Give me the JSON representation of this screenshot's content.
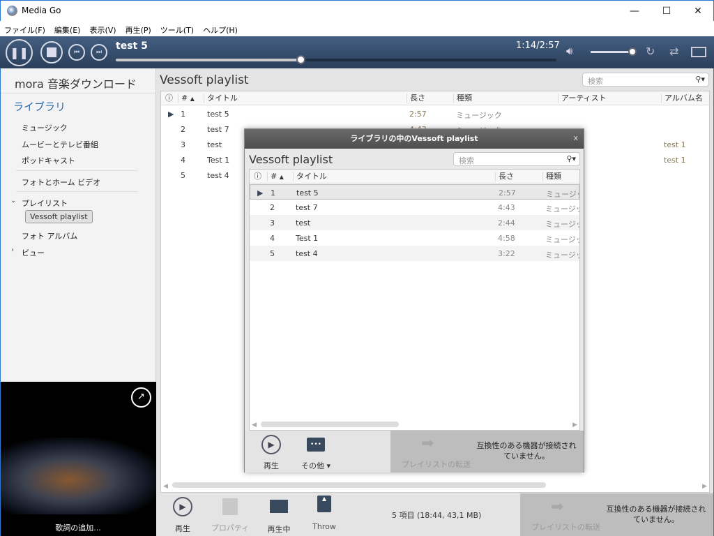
{
  "window": {
    "title": "Media Go",
    "minimize": "—",
    "maximize": "☐",
    "close": "✕"
  },
  "menu": [
    "ファイル(F)",
    "編集(E)",
    "表示(V)",
    "再生(P)",
    "ツール(T)",
    "ヘルプ(H)"
  ],
  "player": {
    "track": "test 5",
    "time": "1:14/2:57",
    "progress": 0.42,
    "volume": 1.0
  },
  "sidebar": {
    "mora": "mora 音楽ダウンロード",
    "library": "ライブラリ",
    "items": [
      "ミュージック",
      "ムービーとテレビ番組",
      "ポッドキャスト",
      "フォトとホーム ビデオ",
      "プレイリスト",
      "Vessoft playlist",
      "フォト アルバム",
      "ビュー"
    ],
    "lyrics": "歌詞の追加..."
  },
  "main": {
    "title": "Vessoft playlist",
    "search_placeholder": "検索",
    "columns": [
      "#",
      "タイトル",
      "長さ",
      "種類",
      "アーティスト",
      "アルバム名"
    ],
    "rows": [
      {
        "n": "1",
        "title": "test 5",
        "len": "2:57",
        "type": "ミュージック",
        "album": ""
      },
      {
        "n": "2",
        "title": "test 7",
        "len": "4:43",
        "type": "ミュージック",
        "album": ""
      },
      {
        "n": "3",
        "title": "test",
        "len": "",
        "type": "",
        "album": "test 1"
      },
      {
        "n": "4",
        "title": "Test 1",
        "len": "",
        "type": "",
        "album": "test 1"
      },
      {
        "n": "5",
        "title": "test 4",
        "len": "",
        "type": "",
        "album": ""
      }
    ],
    "toolbar": {
      "play": "再生",
      "properties": "プロパティ",
      "now_playing": "再生中",
      "throw": "Throw",
      "status": "5 項目 (18:44, 43,1 MB)",
      "transfer": "プレイリストの転送",
      "no_device": "互換性のある機器が接続されていません。"
    }
  },
  "dialog": {
    "title": "ライブラリの中のVessoft playlist",
    "close": "x",
    "heading": "Vessoft playlist",
    "search_placeholder": "検索",
    "columns": [
      "#",
      "タイトル",
      "長さ",
      "種類"
    ],
    "rows": [
      {
        "n": "1",
        "title": "test 5",
        "len": "2:57",
        "type": "ミュージック"
      },
      {
        "n": "2",
        "title": "test 7",
        "len": "4:43",
        "type": "ミュージック"
      },
      {
        "n": "3",
        "title": "test",
        "len": "2:44",
        "type": "ミュージック"
      },
      {
        "n": "4",
        "title": "Test 1",
        "len": "4:58",
        "type": "ミュージック"
      },
      {
        "n": "5",
        "title": "test 4",
        "len": "3:22",
        "type": "ミュージック"
      }
    ],
    "toolbar": {
      "play": "再生",
      "more": "その他 ▾",
      "transfer": "プレイリストの転送",
      "no_device": "互換性のある機器が接続されていません。"
    }
  }
}
